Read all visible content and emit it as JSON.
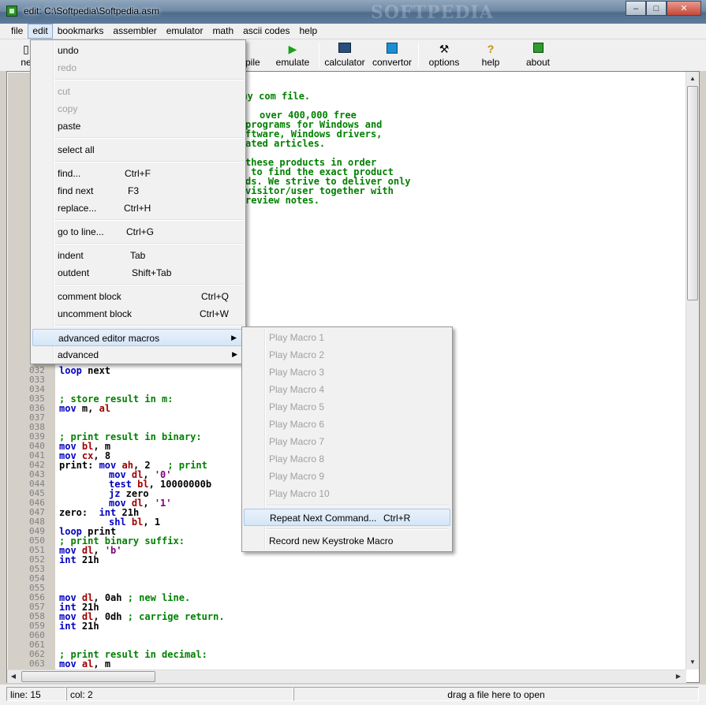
{
  "window": {
    "title": "edit: C:\\Softpedia\\Softpedia.asm",
    "watermark": "SOFTPEDIA",
    "minimize": "–",
    "maximize": "□",
    "close": "✕"
  },
  "menubar": [
    "file",
    "edit",
    "bookmarks",
    "assembler",
    "emulator",
    "math",
    "ascii codes",
    "help"
  ],
  "toolbar": {
    "new_partial": "ne",
    "compile_partial": "npile",
    "emulate": "emulate",
    "calculator": "calculator",
    "convertor": "convertor",
    "options": "options",
    "help": "help",
    "about": "about"
  },
  "edit_menu": {
    "undo": "undo",
    "redo": "redo",
    "cut": "cut",
    "copy": "copy",
    "paste": "paste",
    "select_all": "select all",
    "find": "find...",
    "find_key": "Ctrl+F",
    "find_next": "find next",
    "find_next_key": "F3",
    "replace": "replace...",
    "replace_key": "Ctrl+H",
    "goto": "go to line...",
    "goto_key": "Ctrl+G",
    "indent": "indent",
    "indent_key": "Tab",
    "outdent": "outdent",
    "outdent_key": "Shift+Tab",
    "comment": "comment block",
    "comment_key": "Ctrl+Q",
    "uncomment": "uncomment block",
    "uncomment_key": "Ctrl+W",
    "macros": "advanced editor macros",
    "advanced": "advanced"
  },
  "macro_menu": {
    "play": [
      "Play Macro 1",
      "Play Macro 2",
      "Play Macro 3",
      "Play Macro 4",
      "Play Macro 5",
      "Play Macro 6",
      "Play Macro 7",
      "Play Macro 8",
      "Play Macro 9",
      "Play Macro 10"
    ],
    "repeat": "Repeat Next Command...",
    "repeat_key": "Ctrl+R",
    "record": "Record new Keystroke Macro"
  },
  "code_top": [
    "tiny com file.",
    "",
    "over 400,000 free",
    "programs for Windows and",
    "ftware, Windows drivers,",
    "ated articles.",
    "",
    "these products in order",
    " to find the exact product",
    "ds. We strive to deliver only",
    "visitor/user together with",
    "review notes."
  ],
  "line_numbers": [
    "032",
    "033",
    "034",
    "035",
    "036",
    "037",
    "038",
    "039",
    "040",
    "041",
    "042",
    "043",
    "044",
    "045",
    "046",
    "047",
    "048",
    "049",
    "050",
    "051",
    "052",
    "053",
    "054",
    "055",
    "056",
    "057",
    "058",
    "059",
    "060",
    "061",
    "062",
    "063"
  ],
  "code": {
    "l032_a": "loop",
    "l032_b": " next",
    "l035": "; store result in m:",
    "l036_a": "mov",
    "l036_b": " m, ",
    "l036_c": "al",
    "l039": "; print result in binary:",
    "l040_a": "mov",
    "l040_b": " bl",
    "l040_c": ", m",
    "l041_a": "mov",
    "l041_b": " cx",
    "l041_c": ", 8",
    "l042_a": "print: ",
    "l042_b": "mov",
    "l042_c": " ah",
    "l042_d": ", 2   ",
    "l042_e": "; print",
    "l043_a": "mov",
    "l043_b": " dl",
    "l043_c": ", ",
    "l043_d": "'0'",
    "l044_a": "test",
    "l044_b": " bl",
    "l044_c": ", 10000000b",
    "l045_a": "jz",
    "l045_b": " zero",
    "l046_a": "mov",
    "l046_b": " dl",
    "l046_c": ", ",
    "l046_d": "'1'",
    "l047_a": "zero:  ",
    "l047_b": "int",
    "l047_c": " 21h",
    "l048_a": "shl",
    "l048_b": " bl",
    "l048_c": ", 1",
    "l049_a": "loop",
    "l049_b": " print",
    "l050": "; print binary suffix:",
    "l051_a": "mov",
    "l051_b": " dl",
    "l051_c": ", ",
    "l051_d": "'b'",
    "l052_a": "int",
    "l052_b": " 21h",
    "l056_a": "mov",
    "l056_b": " dl",
    "l056_c": ", 0ah ",
    "l056_d": "; new line.",
    "l057_a": "int",
    "l057_b": " 21h",
    "l058_a": "mov",
    "l058_b": " dl",
    "l058_c": ", 0dh ",
    "l058_d": "; carrige return.",
    "l059_a": "int",
    "l059_b": " 21h",
    "l062": "; print result in decimal:",
    "l063_a": "mov",
    "l063_b": " al",
    "l063_c": ", m"
  },
  "status": {
    "line": "line: 15",
    "col": "col: 2",
    "hint": "drag a file here to open"
  }
}
